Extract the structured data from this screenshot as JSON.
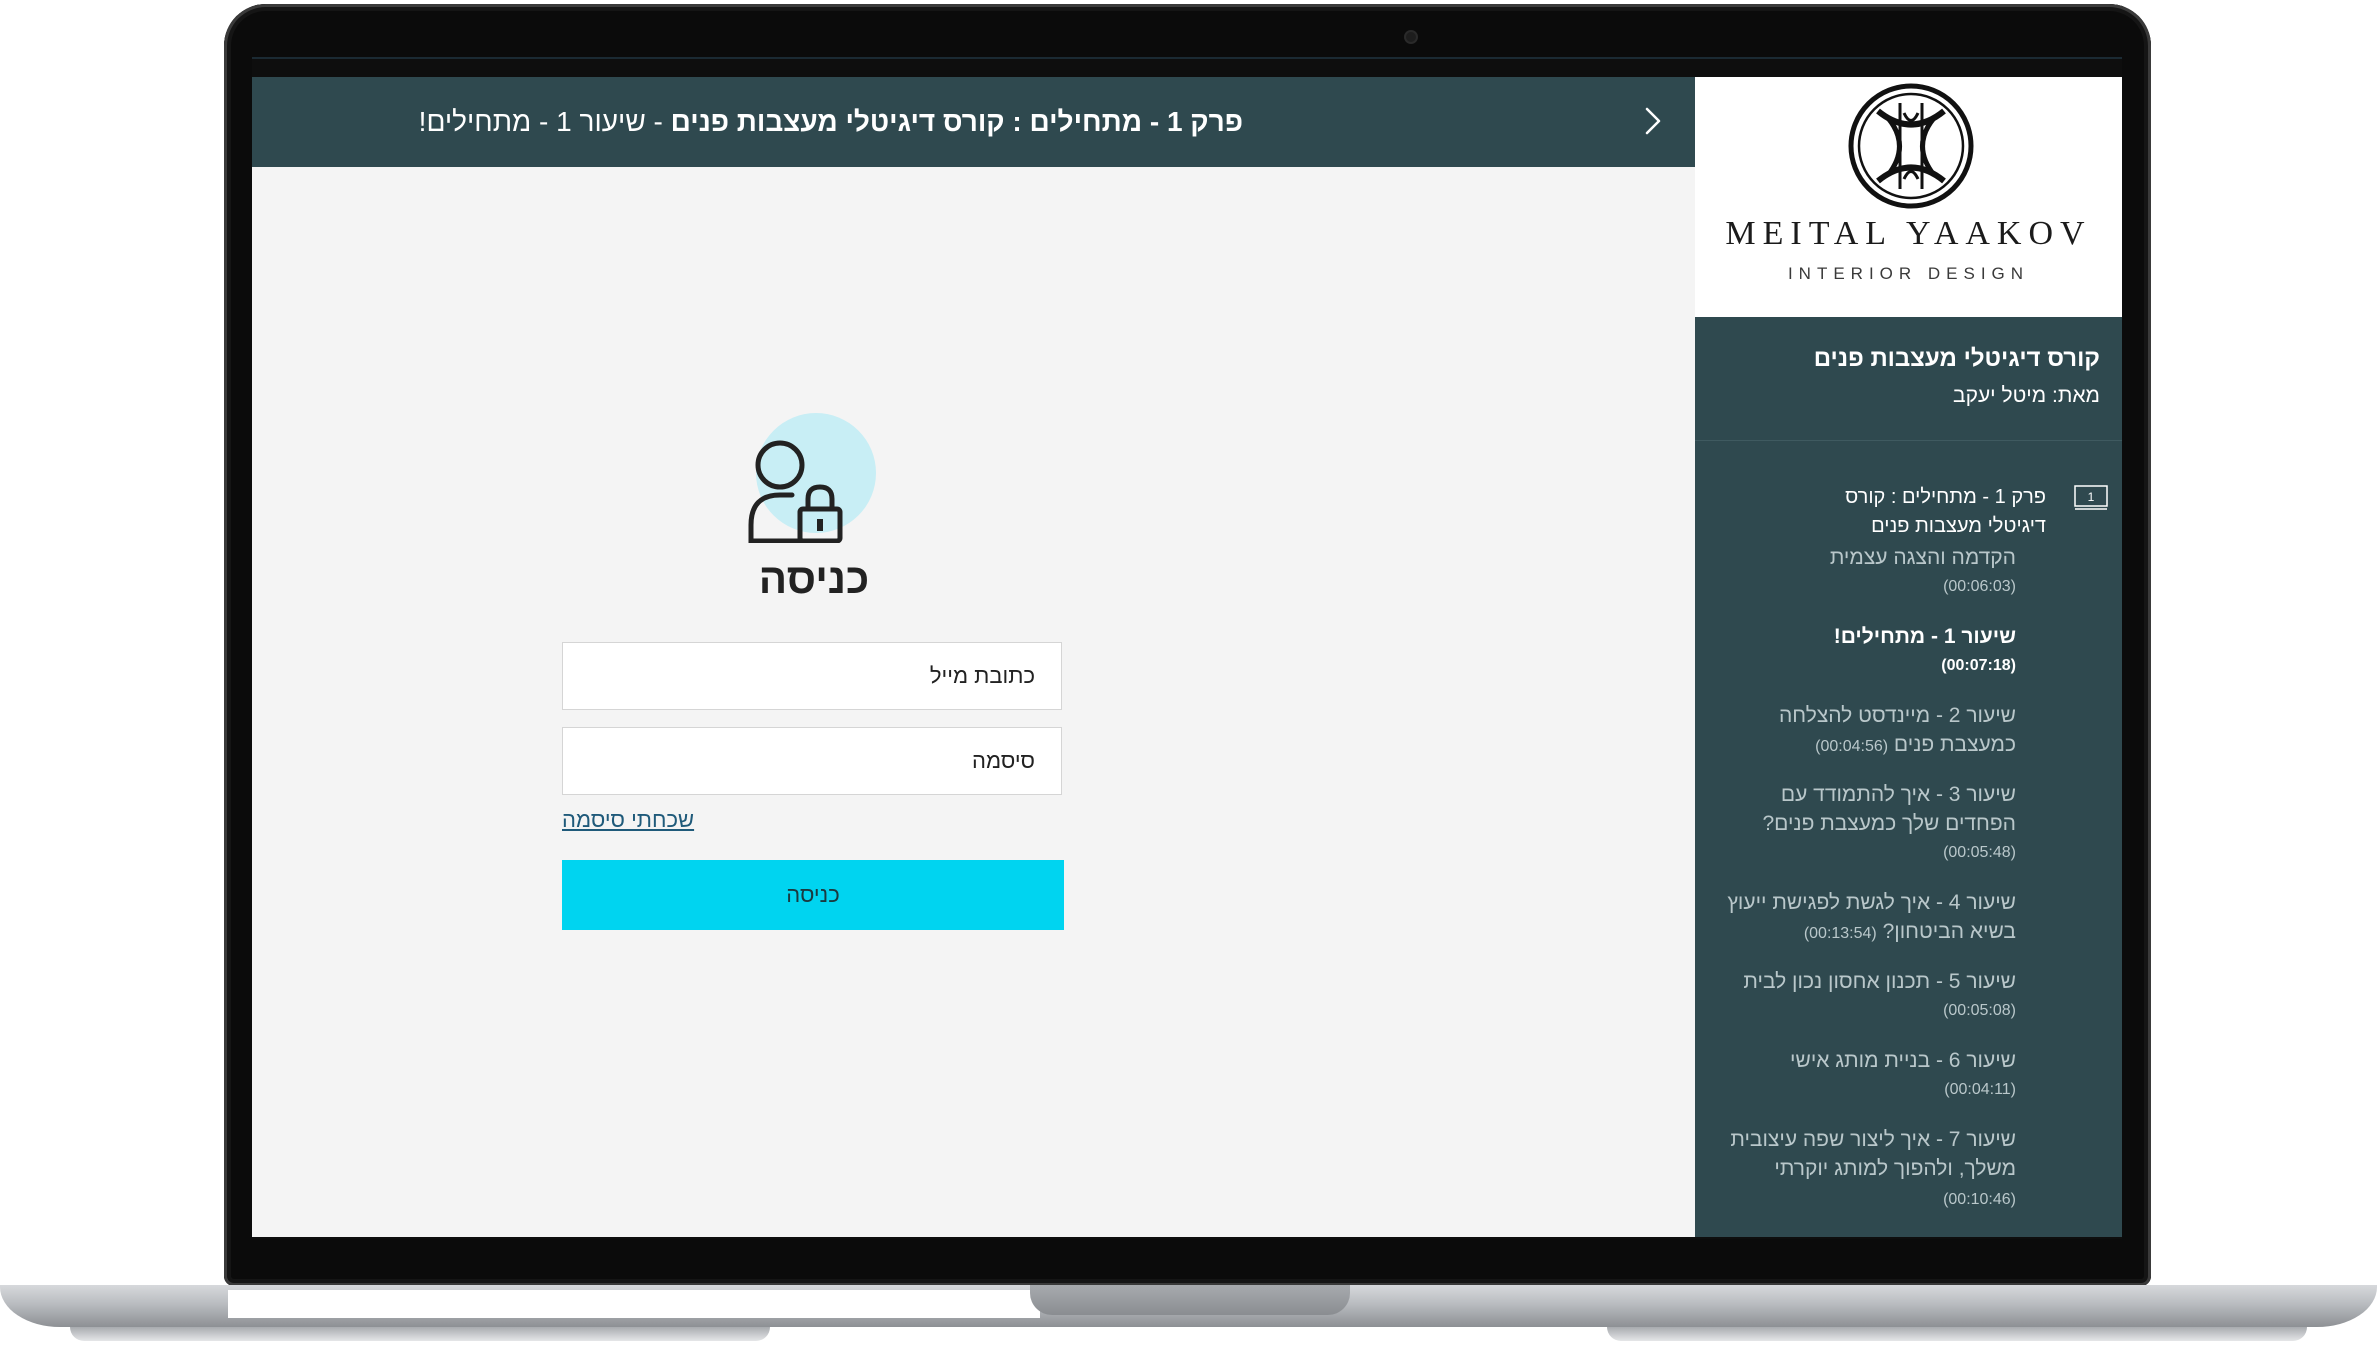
{
  "header": {
    "lesson_title_bold": "פרק 1 - מתחילים : קורס דיגיטלי מעצבות פנים",
    "lesson_title_rest": " - שיעור 1 - מתחילים!"
  },
  "login": {
    "heading": "כניסה",
    "email_placeholder": "כתובת מייל",
    "password_placeholder": "סיסמה",
    "forgot_label": "שכחתי סיסמה",
    "submit_label": "כניסה"
  },
  "brand": {
    "name": "MEITAL YAAKOV",
    "subtitle": "INTERIOR DESIGN"
  },
  "sidebar": {
    "course_title": "קורס דיגיטלי מעצבות פנים",
    "author": "מאת: מיטל יעקב",
    "chapter_number": "1",
    "chapter_title": "פרק 1 - מתחילים : קורס דיגיטלי מעצבות פנים",
    "lessons": [
      {
        "title": "הקדמה והצגה עצמית",
        "duration": "(00:06:03)"
      },
      {
        "title": "שיעור 1 - מתחילים!",
        "duration": "(00:07:18)"
      },
      {
        "title": "שיעור 2 - מיינדסט להצלחה כמעצבת פנים",
        "duration": "(00:04:56)"
      },
      {
        "title": "שיעור 3 - איך להתמודד עם הפחדים שלך כמעצבת פנים?",
        "duration": "(00:05:48)"
      },
      {
        "title": "שיעור 4 - איך לגשת לפגישת ייעוץ בשיא הביטחון?",
        "duration": "(00:13:54)"
      },
      {
        "title": "שיעור 5 - תכנון אחסון נכון לבית",
        "duration": "(00:05:08)"
      },
      {
        "title": "שיעור 6 - בניית מותג אישי",
        "duration": "(00:04:11)"
      },
      {
        "title": "שיעור 7 - איך ליצור שפה עיצובית משלך, ולהפוך למותג יוקרתי",
        "duration": "(00:10:46)"
      }
    ]
  },
  "colors": {
    "header_bg": "#2f494f",
    "page_bg": "#f4f4f4",
    "accent_button": "#00d4f0",
    "avatar_circle": "#c8eef5",
    "link": "#1f5a7a"
  },
  "icons": {
    "next": "chevron-right-icon",
    "login": "user-lock-icon",
    "chapter": "monitor-icon",
    "logo": "monogram-logo"
  }
}
